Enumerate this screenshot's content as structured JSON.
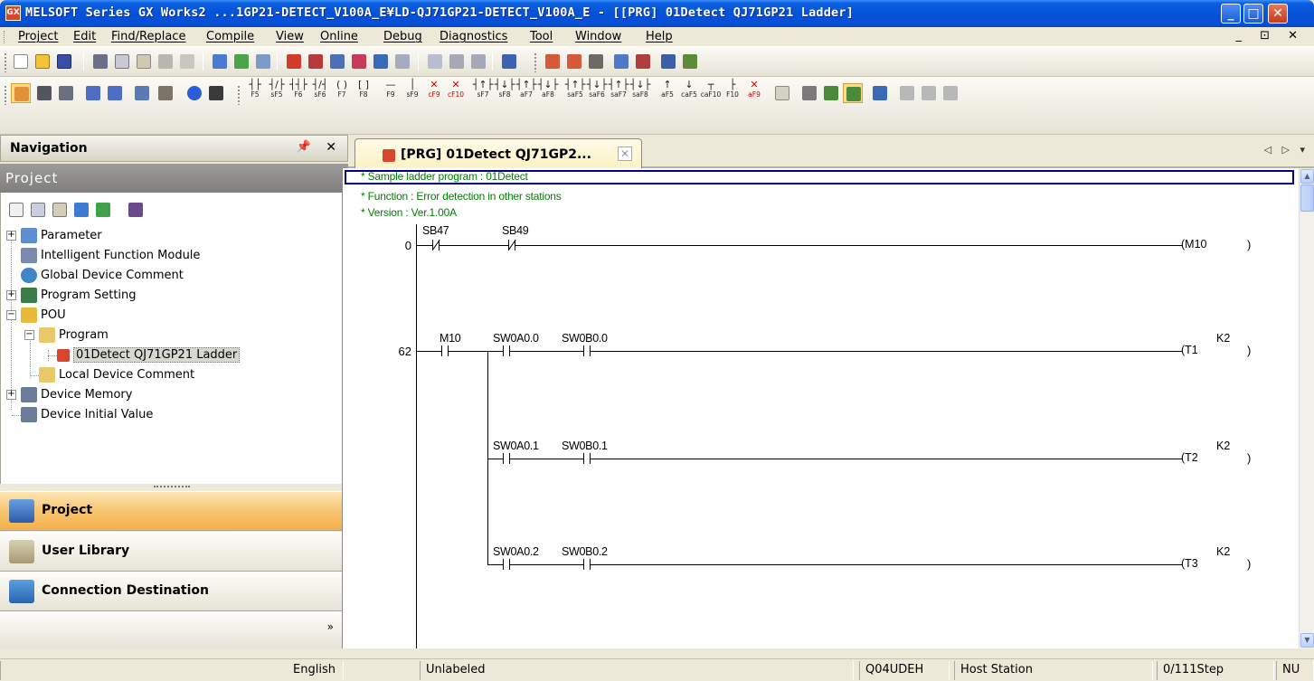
{
  "window": {
    "title": "MELSOFT Series GX Works2 ...1GP21-DETECT_V100A_E¥LD-QJ71GP21-DETECT_V100A_E - [[PRG] 01Detect QJ71GP21 Ladder]",
    "app_icon": "GX",
    "buttons": {
      "minimize": "_",
      "maximize": "□",
      "close": "✕"
    }
  },
  "menu": {
    "items": [
      "Project",
      "Edit",
      "Find/Replace",
      "Compile",
      "View",
      "Online",
      "Debug",
      "Diagnostics",
      "Tool",
      "Window",
      "Help"
    ],
    "mdi_controls": "_ ⊡ ✕"
  },
  "toolbar2": {
    "fkeys": [
      {
        "sym": "┤├",
        "key": "F5"
      },
      {
        "sym": "┤/├",
        "key": "sF5"
      },
      {
        "sym": "┤┤├",
        "key": "F6"
      },
      {
        "sym": "┤/┤",
        "key": "sF6"
      },
      {
        "sym": "( )",
        "key": "F7"
      },
      {
        "sym": "[ ]",
        "key": "F8"
      },
      {
        "sym": "—",
        "key": "F9"
      },
      {
        "sym": "│",
        "key": "sF9"
      },
      {
        "sym": "✕",
        "key": "cF9"
      },
      {
        "sym": "✕",
        "key": "cF10"
      },
      {
        "sym": "┤↑├",
        "key": "sF7"
      },
      {
        "sym": "┤↓├",
        "key": "sF8"
      },
      {
        "sym": "┤↑├",
        "key": "aF7"
      },
      {
        "sym": "┤↓├",
        "key": "aF8"
      },
      {
        "sym": "┤↑├",
        "key": "saF5"
      },
      {
        "sym": "┤↓├",
        "key": "saF6"
      },
      {
        "sym": "┤↑├",
        "key": "saF7"
      },
      {
        "sym": "┤↓├",
        "key": "saF8"
      },
      {
        "sym": "↑",
        "key": "aF5"
      },
      {
        "sym": "↓",
        "key": "caF5"
      },
      {
        "sym": "┬",
        "key": "caF10"
      },
      {
        "sym": "├",
        "key": "F10"
      },
      {
        "sym": "✕",
        "key": "aF9"
      }
    ]
  },
  "navigation": {
    "header": "Navigation",
    "pin": "ᅟ",
    "close": "✕",
    "project_header": "Project",
    "tree": [
      {
        "label": "Parameter",
        "expander": "+"
      },
      {
        "label": "Intelligent Function Module"
      },
      {
        "label": "Global Device Comment"
      },
      {
        "label": "Program Setting",
        "expander": "+"
      },
      {
        "label": "POU",
        "expander": "−"
      },
      {
        "label": "Program",
        "expander": "−"
      },
      {
        "label": "01Detect QJ71GP21 Ladder"
      },
      {
        "label": "Local Device Comment"
      },
      {
        "label": "Device Memory",
        "expander": "+"
      },
      {
        "label": "Device Initial Value"
      }
    ],
    "buttons": [
      "Project",
      "User Library",
      "Connection Destination"
    ],
    "more": "»"
  },
  "document": {
    "tab_label": "[PRG] 01Detect QJ71GP2...",
    "tab_close": "✕",
    "tab_arrows": "◁ ▷ ▾"
  },
  "ladder": {
    "comments": [
      "* Sample ladder program : 01Detect",
      "* Function : Error detection in other stations",
      "* Version : Ver.1.00A"
    ],
    "rungs": [
      {
        "step": "0",
        "contacts": [
          "SB47",
          "SB49"
        ],
        "coil": "M10",
        "coil_k": ""
      },
      {
        "step": "62",
        "contacts": [
          "M10",
          "SW0A0.0",
          "SW0B0.0"
        ],
        "coil": "T1",
        "coil_k": "K2"
      },
      {
        "step": "",
        "contacts": [
          "SW0A0.1",
          "SW0B0.1"
        ],
        "coil": "T2",
        "coil_k": "K2"
      },
      {
        "step": "",
        "contacts": [
          "SW0A0.2",
          "SW0B0.2"
        ],
        "coil": "T3",
        "coil_k": "K2"
      }
    ],
    "coil_open": "(",
    "coil_close": ")"
  },
  "status": {
    "language": "English",
    "label_mode": "Unlabeled",
    "cpu": "Q04UDEH",
    "station": "Host Station",
    "step": "0/111Step",
    "numlock": "NU"
  },
  "colors": {
    "title_blue": "#0552d6",
    "comment_green": "#008000",
    "cursor_navy": "#00008b",
    "active_nav": "#f8c571"
  }
}
